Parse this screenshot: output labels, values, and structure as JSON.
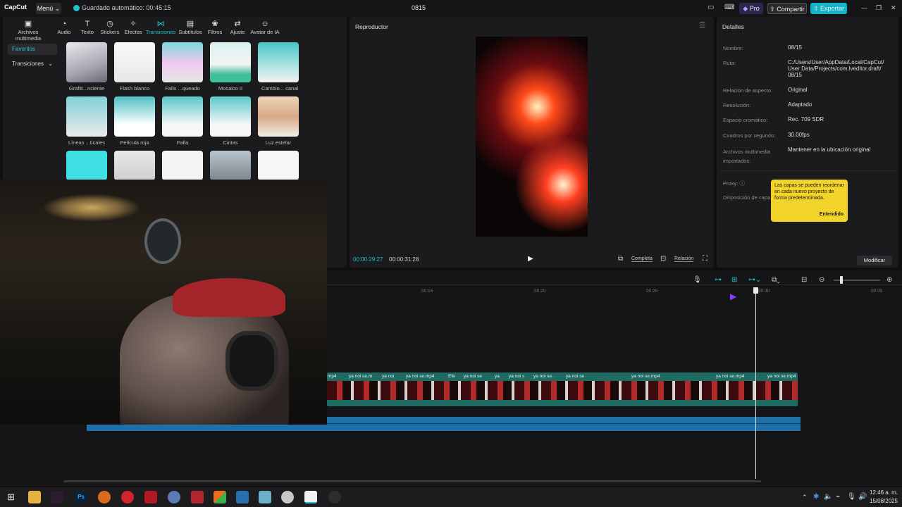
{
  "app": {
    "logo": "CapCut",
    "menu": "Menú",
    "autosave": "Guardado automático: 00:45:15",
    "project_title": "0815",
    "pro": "Pro",
    "share": "Compartir",
    "export": "Exportar"
  },
  "toolbar": {
    "items": [
      {
        "label": "Archivos multimedia",
        "icon": "media-icon"
      },
      {
        "label": "Audio",
        "icon": "audio-icon"
      },
      {
        "label": "Texto",
        "icon": "text-icon"
      },
      {
        "label": "Stickers",
        "icon": "sticker-icon"
      },
      {
        "label": "Efectos",
        "icon": "effects-icon"
      },
      {
        "label": "Transiciones",
        "icon": "transitions-icon"
      },
      {
        "label": "Subtítulos",
        "icon": "subtitles-icon"
      },
      {
        "label": "Filtros",
        "icon": "filters-icon"
      },
      {
        "label": "Ajuste",
        "icon": "adjust-icon"
      },
      {
        "label": "Avatar de IA",
        "icon": "ai-avatar-icon"
      }
    ]
  },
  "sidebar": {
    "favorites": "Favoritos",
    "transitions": "Transiciones"
  },
  "library": {
    "row1": [
      "Grafiti...nciente",
      "Flash blanco",
      "Fallo ...queado",
      "Mosaico II",
      "Cambio... canal"
    ],
    "row2": [
      "Líneas ...ticales",
      "Película roja",
      "Falla",
      "Cintas",
      "Luz estelar"
    ]
  },
  "player": {
    "title": "Reproductor",
    "current_time": "00:00:29:27",
    "total_time": "00:00:31:28",
    "full_label": "Completa",
    "ratio_label": "Relación"
  },
  "details": {
    "title": "Detalles",
    "rows": [
      {
        "key": "Nombre:",
        "value": "08/15"
      },
      {
        "key": "Ruta:",
        "value": "C:/Users/User/AppData/Local/CapCut/ User Data/Projects/com.lveditor.draft/ 08/15"
      },
      {
        "key": "Relación de aspecto:",
        "value": "Original"
      },
      {
        "key": "Resolución:",
        "value": "Adaptado"
      },
      {
        "key": "Espacio cromático:",
        "value": "Rec. 709 SDR"
      },
      {
        "key": "Cuadros por segundo:",
        "value": "30.00fps"
      },
      {
        "key": "Archivos multimedia importados:",
        "value": "Mantener en la ubicación original"
      }
    ],
    "proxy": "Proxy:",
    "layer_layout": "Disposición de capa",
    "modify": "Modificar"
  },
  "tooltip": {
    "text": "Las capas se pueden reordenar en cada nuevo proyecto de forma predeterminada.",
    "button": "Entendido"
  },
  "timeline": {
    "ticks": [
      "00:15",
      "00:20",
      "00:25",
      "00:30",
      "00:35"
    ],
    "clip_labels": [
      "mp4",
      "ya noi se.m",
      "ya noi",
      "ya noi se.mp4",
      "Efe",
      "ya noi se",
      "ya",
      "ya noi s",
      "ya noi se.",
      "ya noi se",
      "ya noi se.mp4",
      "ya noi se.mp4",
      "ya noi se.mp4"
    ]
  },
  "taskbar": {
    "time": "12:46 a. m.",
    "date": "15/08/2025"
  },
  "colors": {
    "accent": "#1fc3c9",
    "export": "#13b4c8",
    "tooltip": "#f1d32a",
    "clip": "#1e6b64",
    "audio": "#1f6fa8"
  }
}
